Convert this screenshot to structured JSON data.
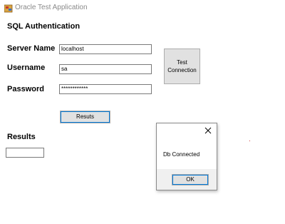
{
  "window": {
    "title": "Oracle Test Application",
    "icon": "app-icon"
  },
  "form": {
    "section_title": "SQL Authentication",
    "server_name_label": "Server Name",
    "server_name_value": "localhost",
    "username_label": "Username",
    "username_value": "sa",
    "password_label": "Password",
    "password_value": "************",
    "test_connection_line1": "Test",
    "test_connection_line2": "Connection",
    "results_button_label": "Resuts",
    "results_label": "Results",
    "results_value": ""
  },
  "dialog": {
    "message": "Db Connected",
    "ok_label": "OK",
    "close_icon": "close-icon"
  },
  "colors": {
    "focus_border": "#0078d7",
    "button_bg": "#e1e1e1",
    "title_text": "#8a8a8a"
  }
}
